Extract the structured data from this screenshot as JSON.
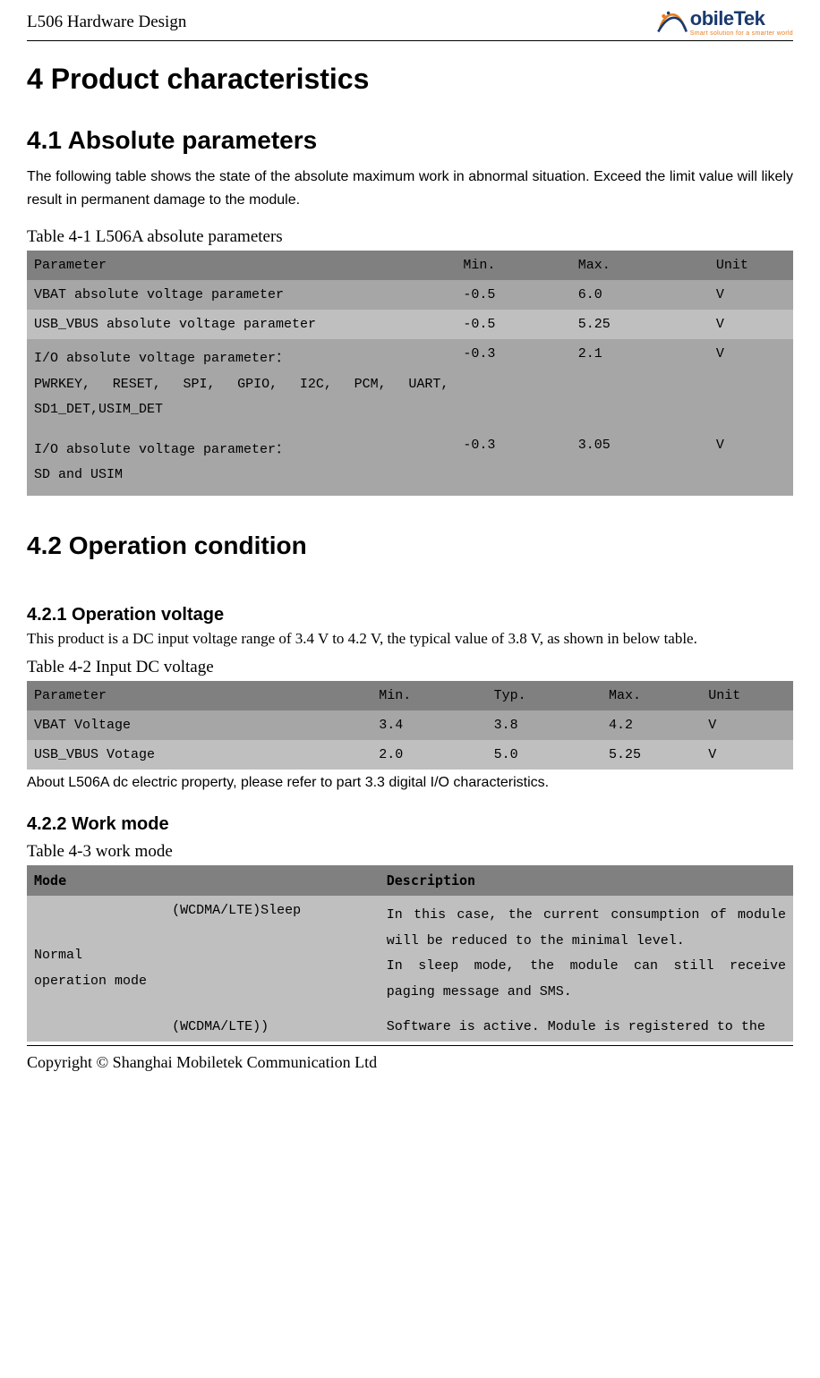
{
  "header": {
    "doc_title": "L506 Hardware Design",
    "logo_text": "obileTek",
    "logo_tagline": "Smart solution for a smarter world"
  },
  "h1": "4 Product characteristics",
  "s41": {
    "heading": "4.1 Absolute parameters",
    "para": "The following table shows the state of the absolute maximum work in abnormal situation. Exceed the limit value will likely result in permanent damage to the module.",
    "caption": "Table 4-1 L506A absolute parameters",
    "head": {
      "p": "Parameter",
      "min": "Min.",
      "max": "Max.",
      "unit": "Unit"
    },
    "rows": [
      {
        "p": "VBAT absolute voltage parameter",
        "min": "-0.5",
        "max": "6.0",
        "unit": "V"
      },
      {
        "p": "USB_VBUS absolute voltage parameter",
        "min": "-0.5",
        "max": "5.25",
        "unit": "V"
      },
      {
        "p": "I/O absolute voltage parameter：\nPWRKEY, RESET, SPI, GPIO, I2C, PCM, UART, SD1_DET,USIM_DET",
        "min": "-0.3",
        "max": "2.1",
        "unit": "V"
      },
      {
        "p": "I/O absolute voltage parameter：\nSD and USIM",
        "min": "-0.3",
        "max": "3.05",
        "unit": "V"
      }
    ]
  },
  "s42": {
    "heading": "4.2 Operation condition"
  },
  "s421": {
    "heading": "4.2.1 Operation voltage",
    "para": "This product is a DC input voltage range of 3.4 V to 4.2 V, the typical value of 3.8 V, as shown in below table.",
    "caption": "Table 4-2 Input DC voltage",
    "head": {
      "p": "Parameter",
      "min": "Min.",
      "typ": "Typ.",
      "max": "Max.",
      "unit": "Unit"
    },
    "rows": [
      {
        "p": "VBAT Voltage",
        "min": "3.4",
        "typ": "3.8",
        "max": "4.2",
        "unit": "V"
      },
      {
        "p": "USB_VBUS Votage",
        "min": "2.0",
        "typ": "5.0",
        "max": "5.25",
        "unit": "V"
      }
    ],
    "note": "About L506A dc electric property, please refer to part 3.3 digital I/O characteristics."
  },
  "s422": {
    "heading": "4.2.2 Work mode",
    "caption": "Table 4-3 work mode",
    "head": {
      "mode": "Mode",
      "desc": "Description"
    },
    "rows": {
      "modecol": "Normal operation mode",
      "r1sub": "(WCDMA/LTE)Sleep",
      "r1desc": "In this case, the current consumption of module will be reduced to the minimal level.\nIn sleep mode, the module can still receive paging message and SMS.",
      "r2sub": "(WCDMA/LTE))",
      "r2desc": "Software is active. Module is registered to the"
    }
  },
  "footer": "Copyright © Shanghai Mobiletek Communication Ltd"
}
